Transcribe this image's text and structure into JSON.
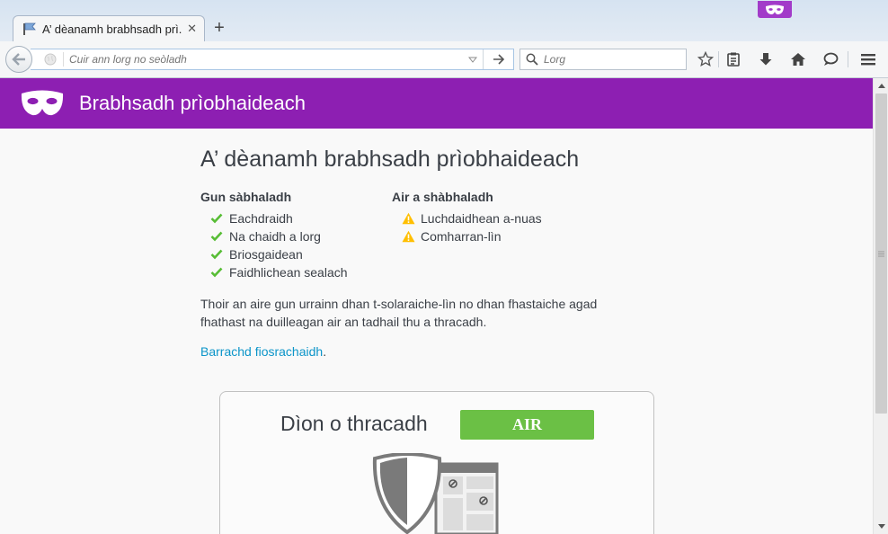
{
  "window": {
    "tab_title": "A’ dèanamh brabhsadh prì...",
    "new_tab_label": "+",
    "tab_close_label": "✕"
  },
  "toolbar": {
    "url_placeholder": "Cuir ann lorg no seòladh",
    "search_placeholder": "Lorg",
    "icons": [
      "back-icon",
      "globe-icon",
      "dropmarker-icon",
      "go-arrow-icon",
      "search-icon",
      "bookmark-star-icon",
      "reading-list-icon",
      "download-icon",
      "home-icon",
      "chat-bubble-icon",
      "menu-icon"
    ]
  },
  "banner": {
    "title": "Brabhsadh prìobhaideach",
    "icon": "private-mask-icon",
    "color": "#8d1fb2"
  },
  "main": {
    "title": "A’ dèanamh brabhsadh prìobhaideach",
    "not_saved": {
      "heading": "Gun sàbhaladh",
      "items": [
        "Eachdraidh",
        "Na chaidh a lorg",
        "Briosgaidean",
        "Faidhlichean sealach"
      ]
    },
    "saved": {
      "heading": "Air a shàbhaladh",
      "items": [
        "Luchdaidhean a-nuas",
        "Comharran-lìn"
      ]
    },
    "note": "Thoir an aire gun urrainn dhan t-solaraiche-lìn no dhan fhastaiche agad fhathast na duilleagan air an tadhail thu a thracadh.",
    "learn_more_link": "Barrachd fiosrachaidh",
    "learn_more_suffix": "."
  },
  "tracking_protection": {
    "title": "Dìon o thracadh",
    "toggle_label": "AIR",
    "toggle_color": "#6bc045"
  },
  "colors": {
    "check": "#57bd35",
    "warning": "#ffbf00",
    "link": "#0c95c9"
  }
}
